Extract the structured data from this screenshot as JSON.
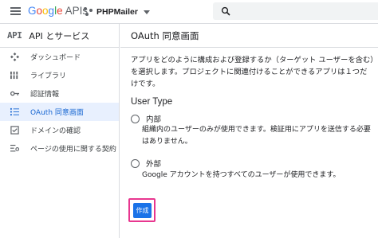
{
  "topbar": {
    "logo_google": [
      "G",
      "o",
      "o",
      "g",
      "l",
      "e"
    ],
    "logo_apis": "APIs",
    "project_name": "PHPMailer"
  },
  "sidebar": {
    "mark": "API",
    "title": "API とサービス",
    "items": [
      {
        "label": "ダッシュボード",
        "icon": "dashboard-icon",
        "active": false
      },
      {
        "label": "ライブラリ",
        "icon": "library-icon",
        "active": false
      },
      {
        "label": "認証情報",
        "icon": "key-icon",
        "active": false
      },
      {
        "label": "OAuth 同意画面",
        "icon": "consent-icon",
        "active": true
      },
      {
        "label": "ドメインの確認",
        "icon": "checkbox-icon",
        "active": false
      },
      {
        "label": "ページの使用に関する契約",
        "icon": "settings-list-icon",
        "active": false
      }
    ]
  },
  "main": {
    "title": "OAuth 同意画面",
    "description": "アプリをどのように構成および登録するか（ターゲット ユーザーを含む）を選択します。プロジェクトに関連付けることができるアプリは１つだけです。",
    "user_type_heading": "User Type",
    "options": [
      {
        "label": "内部",
        "description": "組織内のユーザーのみが使用できます。検証用にアプリを送信する必要はありません。"
      },
      {
        "label": "外部",
        "description": "Google アカウントを持つすべてのユーザーが使用できます。"
      }
    ],
    "create_label": "作成"
  },
  "colors": {
    "accent": "#1a73e8",
    "active_bg": "#e8f0fe",
    "highlight_border": "#e8368f"
  }
}
